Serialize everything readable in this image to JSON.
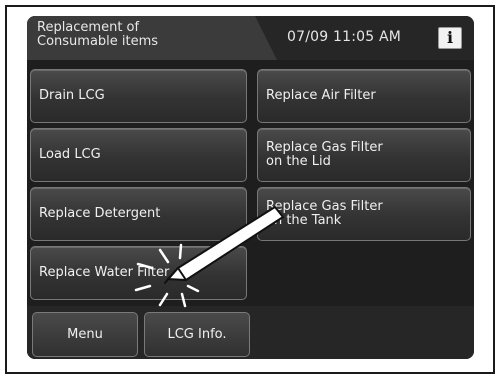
{
  "header": {
    "title_line1": "Replacement of",
    "title_line2": "Consumable items",
    "datetime": "07/09 11:05 AM",
    "info_label": "i"
  },
  "buttons": {
    "drain_lcg": "Drain LCG",
    "load_lcg": "Load LCG",
    "replace_detergent": "Replace Detergent",
    "replace_water_filter": "Replace Water Filter",
    "replace_air_filter": "Replace Air Filter",
    "replace_gas_filter_lid_line1": "Replace Gas Filter",
    "replace_gas_filter_lid_line2": "on the Lid",
    "replace_gas_filter_tank_line1": "Replace Gas Filter",
    "replace_gas_filter_tank_line2": "on the Tank"
  },
  "bottom": {
    "menu": "Menu",
    "lcg_info": "LCG Info."
  },
  "icons": {
    "info": "info-icon",
    "stylus": "stylus-pointer-icon",
    "tap": "tap-indicator-icon"
  },
  "colors": {
    "screen_bg": "#1e1e1e",
    "button_bg": "#3a3a3a",
    "text": "#f0f0f0"
  }
}
